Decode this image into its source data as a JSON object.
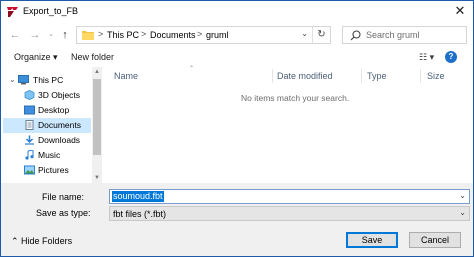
{
  "window": {
    "title": "Export_to_FB"
  },
  "address": {
    "crumbs": [
      "This PC",
      "Documents",
      "gruml"
    ],
    "separator": ">"
  },
  "search": {
    "placeholder": "Search gruml"
  },
  "toolbar": {
    "organize_label": "Organize ▾",
    "new_folder_label": "New folder"
  },
  "nav_tree": [
    {
      "label": "This PC",
      "icon": "computer-icon"
    },
    {
      "label": "3D Objects",
      "icon": "cube-icon"
    },
    {
      "label": "Desktop",
      "icon": "desktop-icon"
    },
    {
      "label": "Documents",
      "icon": "documents-icon"
    },
    {
      "label": "Downloads",
      "icon": "downloads-icon"
    },
    {
      "label": "Music",
      "icon": "music-icon"
    },
    {
      "label": "Pictures",
      "icon": "pictures-icon"
    }
  ],
  "file_list": {
    "columns": [
      "Name",
      "Date modified",
      "Type",
      "Size"
    ],
    "empty_message": "No items match your search."
  },
  "fields": {
    "file_name_label": "File name:",
    "file_name_value": "soumoud.fbt",
    "save_as_type_label": "Save as type:",
    "save_as_type_value": "fbt files (*.fbt)"
  },
  "footer": {
    "hide_folders_label": "Hide Folders",
    "save_label": "Save",
    "cancel_label": "Cancel"
  },
  "colors": {
    "accent": "#0078d7",
    "selection": "#cce8ff",
    "title_icon_red": "#c8102e"
  }
}
